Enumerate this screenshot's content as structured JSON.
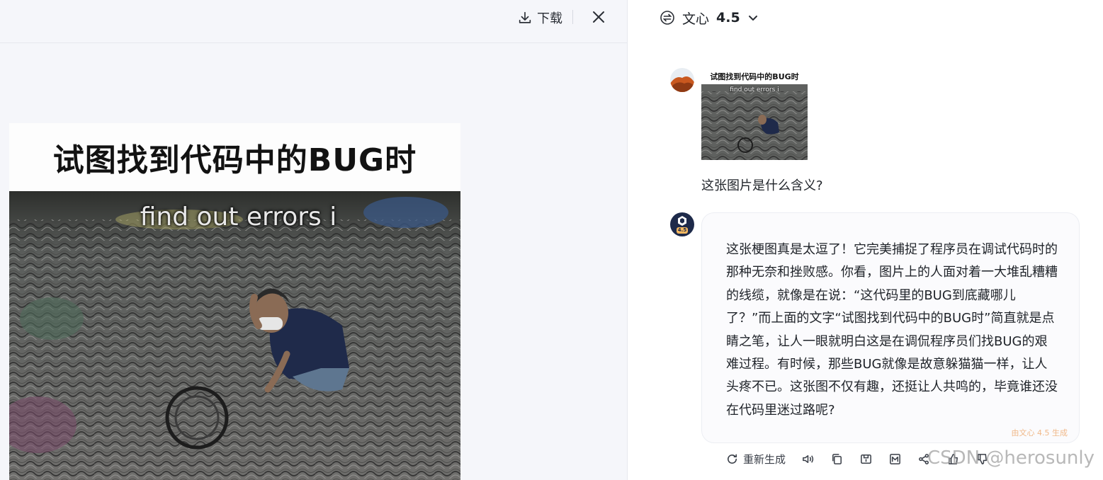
{
  "preview": {
    "download_label": "下载",
    "meme_caption": "试图找到代码中的BUG时",
    "meme_subtitle": "find out errors i"
  },
  "chat": {
    "model_name": "文心",
    "model_version": "4.5",
    "user_image_caption": "试图找到代码中的BUG时",
    "user_image_subtitle": "find out errors i",
    "user_question": "这张图片是什么含义?",
    "bot_avatar_version": "4.5",
    "answer": "这张梗图真是太逗了！它完美捕捉了程序员在调试代码时的那种无奈和挫败感。你看，图片上的人面对着一大堆乱糟糟的线缆，就像是在说：“这代码里的BUG到底藏哪儿了？”而上面的文字“试图找到代码中的BUG时”简直就是点睛之笔，让人一眼就明白这是在调侃程序员们找BUG的艰难过程。有时候，那些BUG就像是故意躲猫猫一样，让人头疼不已。这张图不仅有趣，还挺让人共鸣的，毕竟谁还没在代码里迷过路呢?",
    "generated_tag": "由文心 4.5 生成",
    "regenerate_label": "重新生成",
    "watermark": "CSDN @herosunly"
  },
  "icons": [
    "download-icon",
    "close-icon",
    "model-switch-icon",
    "chevron-down-icon",
    "refresh-icon",
    "speaker-icon",
    "copy-icon",
    "save-icon",
    "image-icon",
    "share-icon",
    "thumbs-up-icon",
    "thumbs-down-icon"
  ],
  "colors": {
    "panel_bg": "#f5f6fa",
    "card_bg": "#fbfbfd",
    "text": "#1f2329",
    "tag": "#f0b98a"
  }
}
